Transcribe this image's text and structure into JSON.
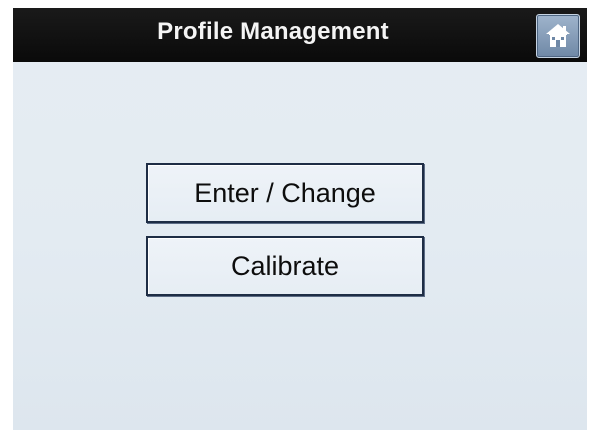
{
  "header": {
    "title": "Profile Management",
    "home_icon": "home-icon"
  },
  "menu": {
    "buttons": [
      {
        "label": "Enter / Change"
      },
      {
        "label": "Calibrate"
      }
    ]
  },
  "colors": {
    "title_bar": "#0f0f0f",
    "screen_background": "#e3ebf2",
    "button_border": "#1e2d45",
    "home_button": "#7f97b5"
  }
}
